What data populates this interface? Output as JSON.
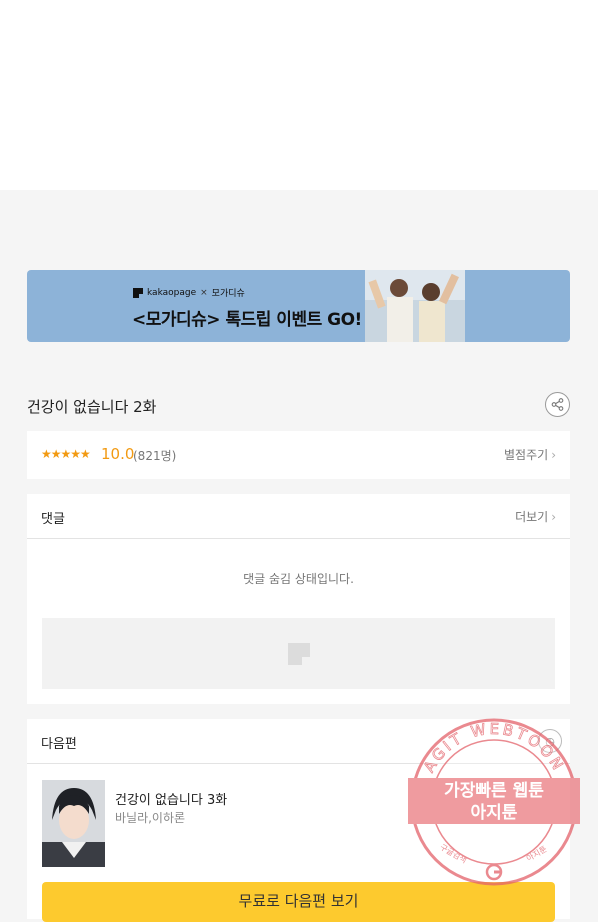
{
  "banner": {
    "brand": "kakaopage",
    "brand_separator": "×",
    "partner": "모가디슈",
    "headline": "<모가디슈> 톡드립 이벤트 GO!"
  },
  "episode": {
    "title": "건강이 없습니다 2화"
  },
  "rating": {
    "stars": "★★★★★",
    "score": "10.0",
    "count": "(821명)",
    "rate_label": "별점주기"
  },
  "comments": {
    "header": "댓글",
    "more_label": "더보기",
    "hidden_message": "댓글 숨김 상태입니다."
  },
  "next": {
    "header": "다음편",
    "title": "건강이 없습니다 3화",
    "authors": "바닐라,이하론",
    "button_label": "무료로 다음편 보기"
  },
  "watermark": {
    "ring_text": "AGIT WEBTOON",
    "line1": "가장빠른 웹툰",
    "line2": "아지툰",
    "bottom_left": "구글검색",
    "bottom_right": "아지툰"
  },
  "colors": {
    "accent_orange": "#f29a12",
    "button_yellow": "#fdca2e",
    "banner_blue": "#8db3d8",
    "stamp_red": "#e0525a"
  }
}
